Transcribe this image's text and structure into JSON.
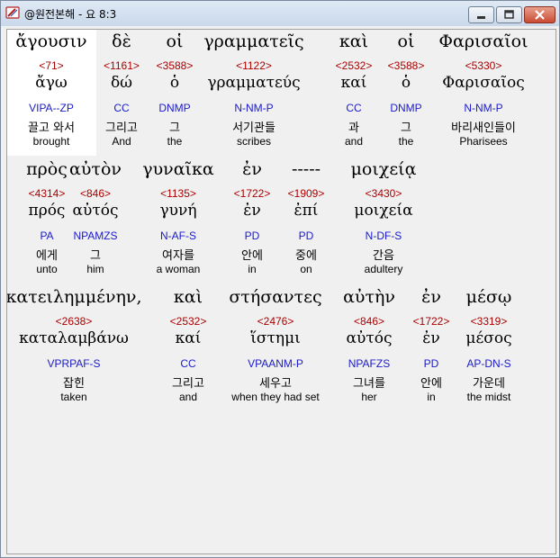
{
  "window": {
    "title": "@원전본해 - 요 8:3"
  },
  "rows": [
    [
      {
        "greek": "ἄγουσιν",
        "num": "<71>",
        "lemma": "ἄγω",
        "parse": "VIPA--ZP",
        "korean": "끌고 와서",
        "english": "brought"
      },
      {
        "greek": "δὲ",
        "num": "<1161>",
        "lemma": "δώ",
        "parse": "CC",
        "korean": "그리고",
        "english": "And"
      },
      {
        "greek": "οἱ",
        "num": "<3588>",
        "lemma": "ὁ",
        "parse": "DNMP",
        "korean": "그",
        "english": "the"
      },
      {
        "greek": "γραμματεῖς",
        "num": "<1122>",
        "lemma": "γραμματεύς",
        "parse": "N-NM-P",
        "korean": "서기관들",
        "english": "scribes"
      },
      {
        "greek": "καὶ",
        "num": "<2532>",
        "lemma": "καί",
        "parse": "CC",
        "korean": "과",
        "english": "and"
      },
      {
        "greek": "οἱ",
        "num": "<3588>",
        "lemma": "ὁ",
        "parse": "DNMP",
        "korean": "그",
        "english": "the"
      },
      {
        "greek": "Φαρισαῖοι",
        "num": "<5330>",
        "lemma": "Φαρισαῖος",
        "parse": "N-NM-P",
        "korean": "바리새인들이",
        "english": "Pharisees"
      }
    ],
    [
      {
        "greek": "πρὸς",
        "num": "<4314>",
        "lemma": "πρός",
        "parse": "PA",
        "korean": "에게",
        "english": "unto"
      },
      {
        "greek": "αὐτὸν",
        "num": "<846>",
        "lemma": "αὐτός",
        "parse": "NPAMZS",
        "korean": "그",
        "english": "him"
      },
      {
        "greek": "γυναῖκα",
        "num": "<1135>",
        "lemma": "γυνή",
        "parse": "N-AF-S",
        "korean": "여자를",
        "english": "a woman"
      },
      {
        "greek": "ἐν",
        "num": "<1722>",
        "lemma": "ἐν",
        "parse": "PD",
        "korean": "안에",
        "english": "in"
      },
      {
        "greek": "-----",
        "num": "<1909>",
        "lemma": "ἐπί",
        "parse": "PD",
        "korean": "중에",
        "english": "on"
      },
      {
        "greek": "μοιχείᾳ",
        "num": "<3430>",
        "lemma": "μοιχεία",
        "parse": "N-DF-S",
        "korean": "간음",
        "english": "adultery"
      }
    ],
    [
      {
        "greek": "κατειλημμένην,",
        "num": "<2638>",
        "lemma": "καταλαμβάνω",
        "parse": "VPRPAF-S",
        "korean": "잡힌",
        "english": "taken"
      },
      {
        "greek": "καὶ",
        "num": "<2532>",
        "lemma": "καί",
        "parse": "CC",
        "korean": "그리고",
        "english": "and"
      },
      {
        "greek": "στήσαντες",
        "num": "<2476>",
        "lemma": "ἵστημι",
        "parse": "VPAANM-P",
        "korean": "세우고",
        "english": "when they had set"
      },
      {
        "greek": "αὐτὴν",
        "num": "<846>",
        "lemma": "αὐτός",
        "parse": "NPAFZS",
        "korean": "그녀를",
        "english": "her"
      },
      {
        "greek": "ἐν",
        "num": "<1722>",
        "lemma": "ἐν",
        "parse": "PD",
        "korean": "안에",
        "english": "in"
      },
      {
        "greek": "μέσῳ",
        "num": "<3319>",
        "lemma": "μέσος",
        "parse": "AP-DN-S",
        "korean": "가운데",
        "english": "the midst"
      }
    ]
  ]
}
